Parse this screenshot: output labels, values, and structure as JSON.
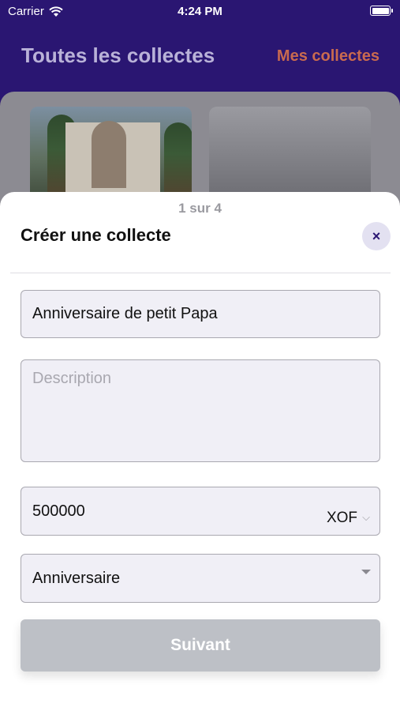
{
  "status_bar": {
    "carrier": "Carrier",
    "time": "4:24 PM"
  },
  "header": {
    "title": "Toutes les collectes",
    "my_collections": "Mes collectes"
  },
  "sheet": {
    "step": "1 sur 4",
    "title": "Créer une collecte",
    "close_icon": "×",
    "name_value": "Anniversaire de petit Papa",
    "description_placeholder": "Description",
    "amount_value": "500000",
    "currency": "XOF",
    "type_value": "Anniversaire",
    "next_label": "Suivant"
  },
  "colors": {
    "header_bg": "#2a1672",
    "accent_link": "#c96a4f",
    "button_disabled": "#bdc0c6"
  }
}
